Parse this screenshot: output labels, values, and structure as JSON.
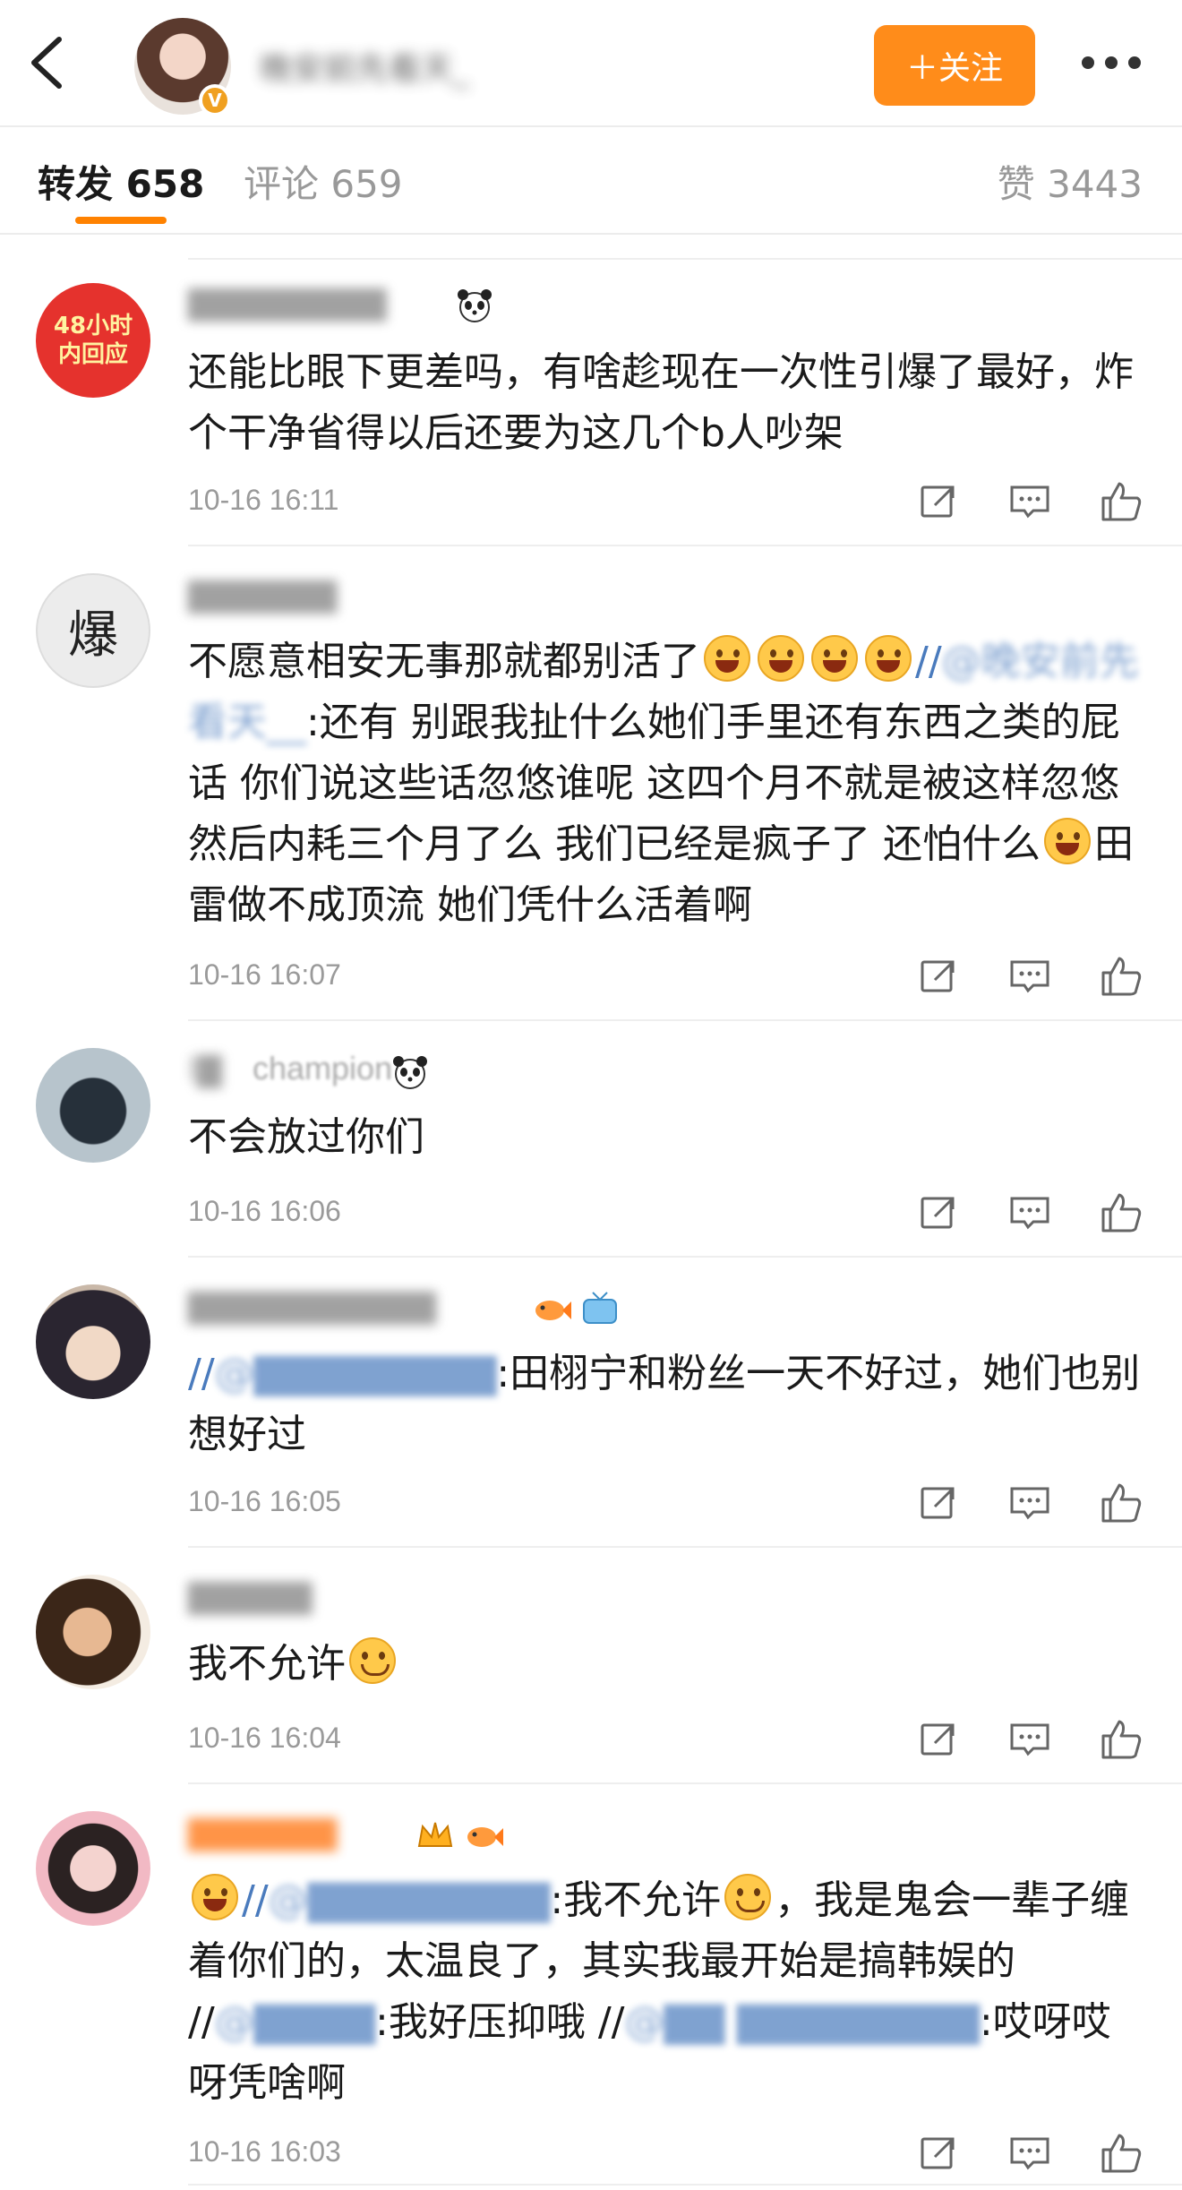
{
  "header": {
    "follow_label": "＋关注",
    "verified_badge": "V",
    "author_name": "晚安前先看天_"
  },
  "tabs": {
    "repost": "转发 658",
    "comment": "评论 659",
    "like": "赞 3443"
  },
  "reposts": [
    {
      "avatar_text": [
        "48小时",
        "内回应"
      ],
      "time": "10-16 16:11",
      "text": "还能比眼下更差吗，有啥趁现在一次性引爆了最好，炸个干净省得以后还要为这几个b人吵架"
    },
    {
      "avatar_text": "爆",
      "time": "10-16 16:07",
      "text_a": "不愿意相安无事那就都别活了",
      "text_b": "//",
      "text_c": ":还有 别跟我扯什么她们手里还有东西之类的屁话 你们说这些话忽悠谁呢 这四个月不就是被这样忽悠然后内耗三个月了么  我们已经是疯子了  还怕什么",
      "text_d": "田雷做不成顶流 她们凭什么活着啊"
    },
    {
      "name_fragment": "champion",
      "time": "10-16 16:06",
      "text": "不会放过你们"
    },
    {
      "time": "10-16 16:05",
      "text_a": "//",
      "text_b": ":田栩宁和粉丝一天不好过，她们也别想好过"
    },
    {
      "time": "10-16 16:04",
      "text": "我不允许"
    },
    {
      "time": "10-16 16:03",
      "text_a": "//",
      "text_b": ":我不允许",
      "text_c": "，我是鬼会一辈子缠着你们的，太温良了，其实我最开始是搞韩娱的 //",
      "text_d": ":我好压抑哦 //",
      "text_e": ":哎呀哎呀凭啥啊"
    }
  ],
  "icons": {
    "repost": "share-icon",
    "comment": "comment-icon",
    "like": "thumb-up-icon"
  },
  "colors": {
    "accent": "#ff8200",
    "follow_bg": "#ff8c1a",
    "mention": "#4a7bbd",
    "time": "#9a9a9a"
  }
}
